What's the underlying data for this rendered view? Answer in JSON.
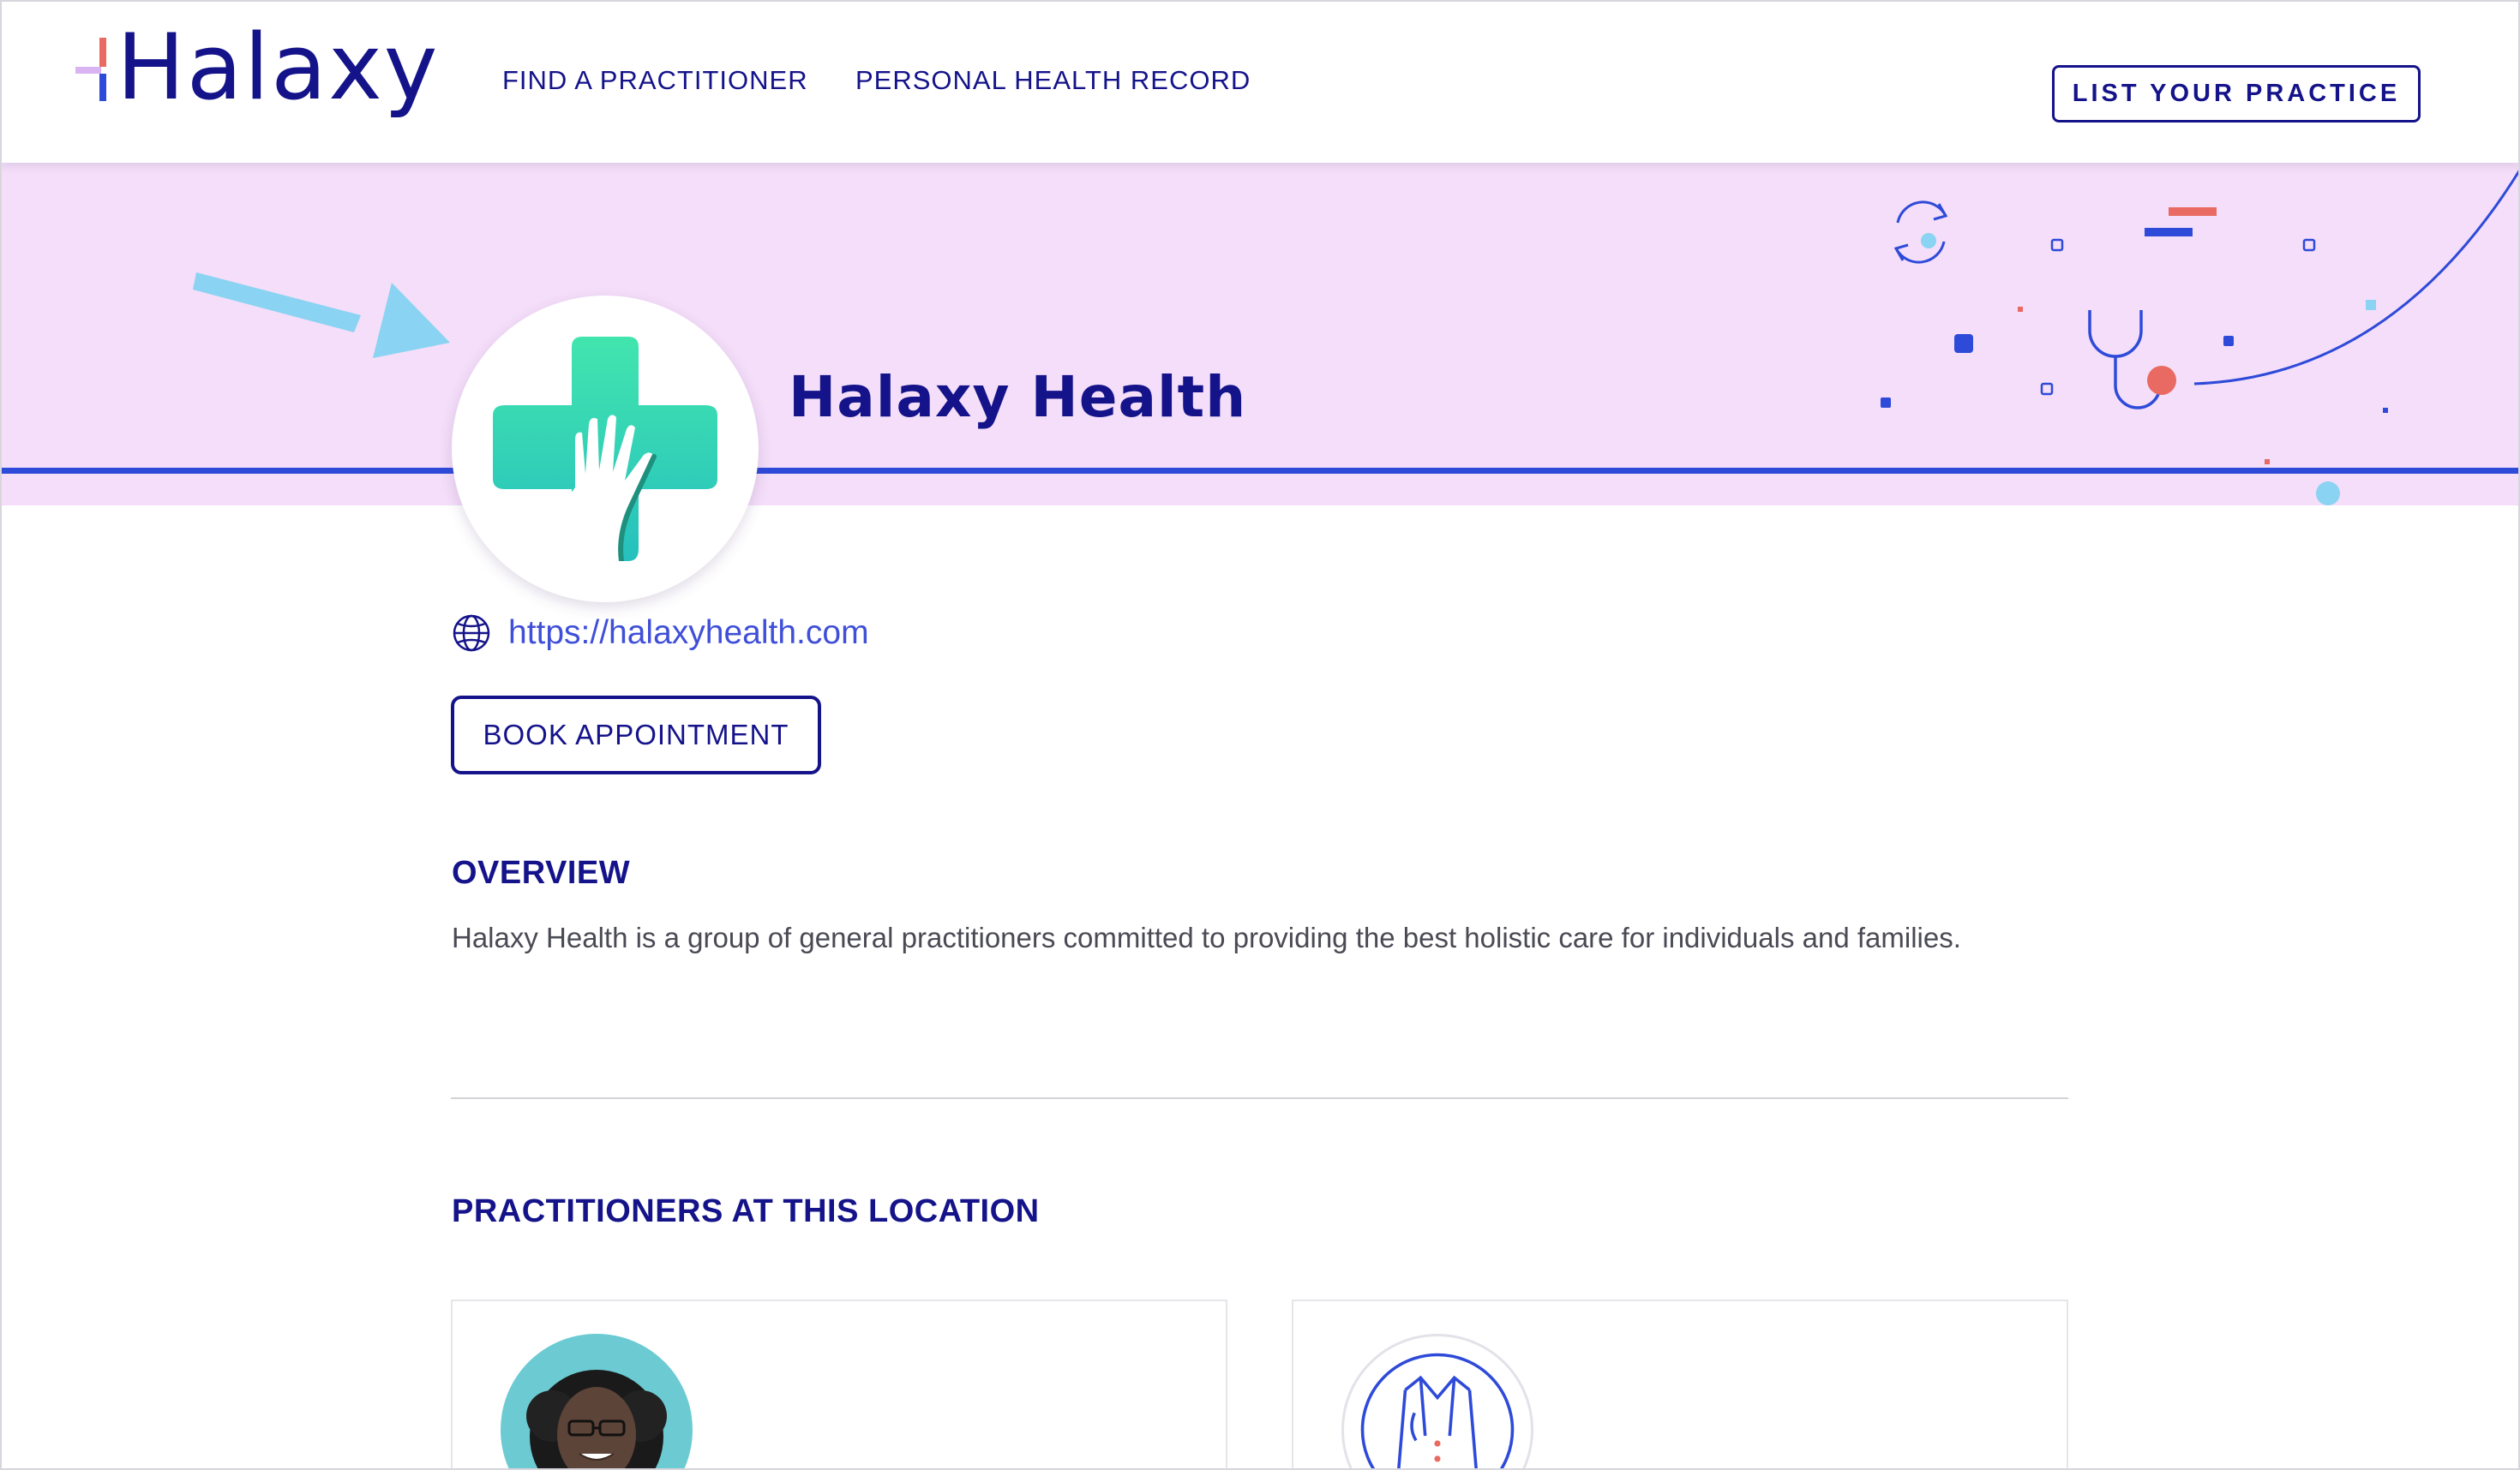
{
  "header": {
    "logo_text": "Halaxy",
    "nav": [
      {
        "label": "FIND A PRACTITIONER"
      },
      {
        "label": "PERSONAL HEALTH RECORD"
      }
    ],
    "list_practice_label": "LIST YOUR PRACTICE"
  },
  "practice": {
    "name": "Halaxy Health",
    "website": "https://halaxyhealth.com",
    "book_label": "BOOK APPOINTMENT"
  },
  "overview": {
    "title": "OVERVIEW",
    "text": "Halaxy Health is a group of general practitioners committed to providing the best holistic care for individuals and families."
  },
  "practitioners": {
    "title": "PRACTITIONERS AT THIS LOCATION"
  },
  "colors": {
    "brand_navy": "#14138a",
    "banner_bg": "#f4def9",
    "accent_blue": "#2e4ad9",
    "link_blue": "#3f4fd8",
    "logo_teal": "#2ecfa8",
    "arrow_blue": "#8ad3f2",
    "coral": "#e86a62"
  }
}
